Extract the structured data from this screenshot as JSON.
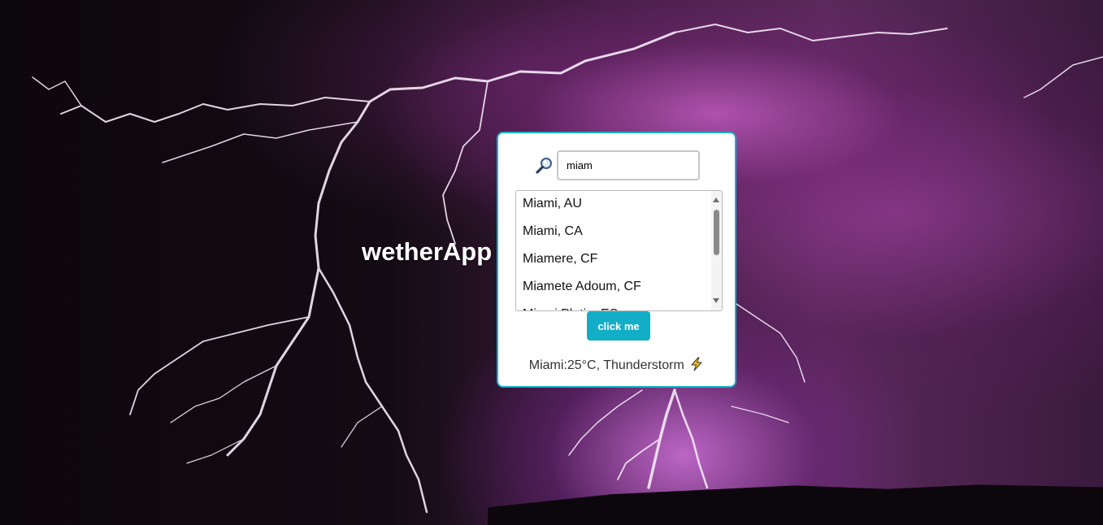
{
  "app": {
    "title": "wetherApp"
  },
  "search": {
    "value": "miam",
    "icon": "magnifier-icon"
  },
  "suggestions": [
    "Miami, AU",
    "Miami, CA",
    "Miamere, CF",
    "Miamete Adoum, CF",
    "Miami Platja, ES"
  ],
  "button": {
    "label": "click me"
  },
  "result": {
    "text": "Miami:25°C, Thunderstorm",
    "icon": "lightning-bolt-icon"
  },
  "colors": {
    "accent": "#12aec8",
    "card_border": "#17b0c9",
    "background": "#120a12"
  }
}
